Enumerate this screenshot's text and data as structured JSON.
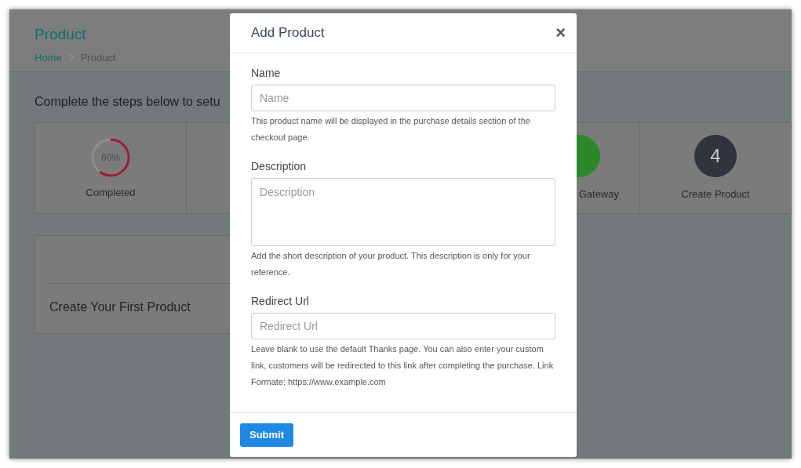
{
  "page": {
    "title": "Product",
    "breadcrumb": [
      {
        "label": "Home",
        "kind": "link"
      },
      {
        "label": "Product",
        "kind": "current"
      }
    ],
    "intro": "Complete the steps below to setu",
    "steps": [
      {
        "kind": "progress",
        "level": 0.6,
        "reading": "60%",
        "label": "Completed"
      },
      {
        "kind": "blank"
      },
      {
        "kind": "covered"
      },
      {
        "kind": "step",
        "color": "#2a8a2a",
        "label": "Gateway"
      },
      {
        "kind": "step",
        "color": "#2f353b",
        "number": "4",
        "label": "Create Product"
      }
    ],
    "first_product": {
      "title": "Create Your First Product"
    }
  },
  "modal": {
    "title": "Add Product",
    "close": "×",
    "fields": [
      {
        "label": "Name",
        "kind": "input",
        "placeholder": "Name",
        "help": "This product name will be displayed in the purchase details section of the checkout page."
      },
      {
        "label": "Description",
        "kind": "textarea",
        "placeholder": "Description",
        "help": "Add the short description of your product. This description is only for your reference."
      },
      {
        "label": "Redirect Url",
        "kind": "input",
        "placeholder": "Redirect Url",
        "help": "Leave blank to use the default Thanks page. You can also enter your custom link, customers will be redirected to this link after completing the purchase. Link Formate: https://www.example.com"
      }
    ],
    "submit": "Submit"
  }
}
